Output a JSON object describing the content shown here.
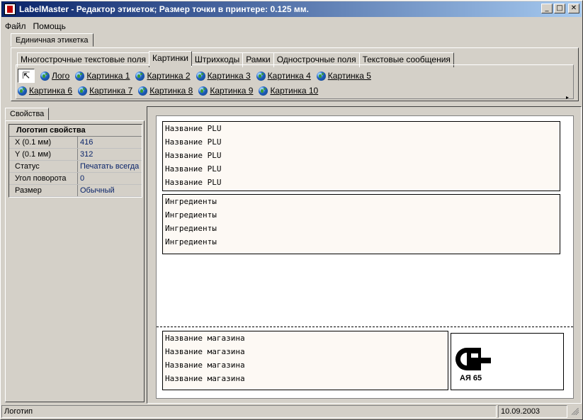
{
  "window": {
    "title": "LabelMaster - Редактор этикеток; Размер точки в принтере: 0.125 мм.",
    "minimize": "_",
    "maximize": "□",
    "close": "✕"
  },
  "menu": [
    "Файл",
    "Помощь"
  ],
  "outer_tab": "Единичная этикетка",
  "inner_tabs": [
    "Многострочные текстовые поля",
    "Картинки",
    "Штрихкоды",
    "Рамки",
    "Однострочные поля",
    "Текстовые сообщения"
  ],
  "pictures_row1": [
    "Лого",
    "Картинка 1",
    "Картинка 2",
    "Картинка 3",
    "Картинка 4",
    "Картинка 5"
  ],
  "pictures_row2": [
    "Картинка 6",
    "Картинка 7",
    "Картинка 8",
    "Картинка 9",
    "Картинка 10"
  ],
  "properties": {
    "tab": "Свойства",
    "heading": "Логотип свойства",
    "rows": [
      {
        "key": "X (0.1 мм)",
        "value": "416"
      },
      {
        "key": "Y (0.1 мм)",
        "value": "312"
      },
      {
        "key": "Статус",
        "value": "Печатать всегда"
      },
      {
        "key": "Угол поворота",
        "value": "0"
      },
      {
        "key": "Размер",
        "value": "Обычный"
      }
    ]
  },
  "label": {
    "plu_lines": [
      "Название PLU",
      "Название PLU",
      "Название PLU",
      "Название PLU",
      "Название PLU"
    ],
    "ingredient_lines": [
      "Ингредиенты",
      "Ингредиенты",
      "Ингредиенты",
      "Ингредиенты"
    ],
    "store_lines": [
      "Название магазина",
      "Название магазина",
      "Название магазина",
      "Название магазина"
    ],
    "logo_code": "АЯ 65"
  },
  "status": {
    "left": "Логотип",
    "right": "10.09.2003"
  }
}
